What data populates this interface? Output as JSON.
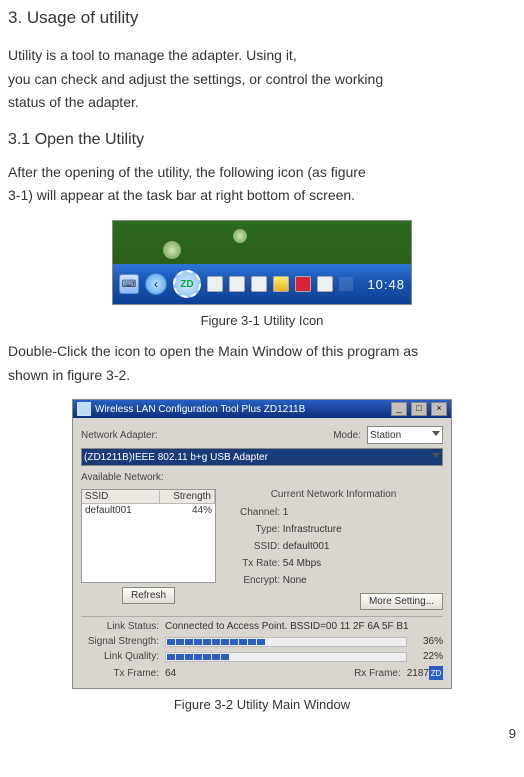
{
  "headings": {
    "section": "3. Usage of utility",
    "subsection": "3.1 Open the Utility"
  },
  "paragraphs": {
    "intro_l1": " Utility is a tool to manage the adapter. Using it,",
    "intro_l2": "you can check and adjust the settings, or control the working",
    "intro_l3": "status of the adapter.",
    "open_l1": "After the opening of the utility, the following icon (as figure",
    "open_l2": "3-1) will appear at the task bar at right bottom of screen.",
    "double_l1": "Double-Click the icon to open the Main Window of this program as",
    "double_l2": "shown in  figure 3-2."
  },
  "captions": {
    "fig31": "Figure 3-1 Utility Icon",
    "fig32": "Figure 3-2 Utility Main Window"
  },
  "taskbar": {
    "icon_main": "ZD",
    "time": "10:48"
  },
  "window": {
    "title": "Wireless LAN Configuration Tool Plus   ZD1211B",
    "labels": {
      "network_adapter": "Network Adapter:",
      "mode": "Mode:",
      "available_network": "Available Network:",
      "current_info": "Current Network Information",
      "channel": "Channel:",
      "type": "Type:",
      "ssid": "SSID:",
      "txrate": "Tx Rate:",
      "encrypt": "Encrypt:",
      "link_status": "Link Status:",
      "signal_strength": "Signal Strength:",
      "link_quality": "Link Quality:",
      "tx_frame": "Tx Frame:",
      "rx_frame": "Rx Frame:"
    },
    "values": {
      "mode": "Station",
      "adapter": "(ZD1211B)IEEE 802.11 b+g USB Adapter",
      "channel": "1",
      "type": "Infrastructure",
      "ssid": "default001",
      "txrate": "54 Mbps",
      "encrypt": "None",
      "link_status": "Connected to Access Point. BSSID=00 11 2F 6A 5F B1",
      "signal_pct": "36%",
      "quality_pct": "22%",
      "tx_frame": "64",
      "rx_frame": "2187"
    },
    "table": {
      "col_ssid": "SSID",
      "col_strength": "Strength",
      "rows": [
        {
          "ssid": "default001",
          "strength": "44%"
        }
      ]
    },
    "buttons": {
      "refresh": "Refresh",
      "more": "More Setting..."
    }
  },
  "page_number": "9"
}
